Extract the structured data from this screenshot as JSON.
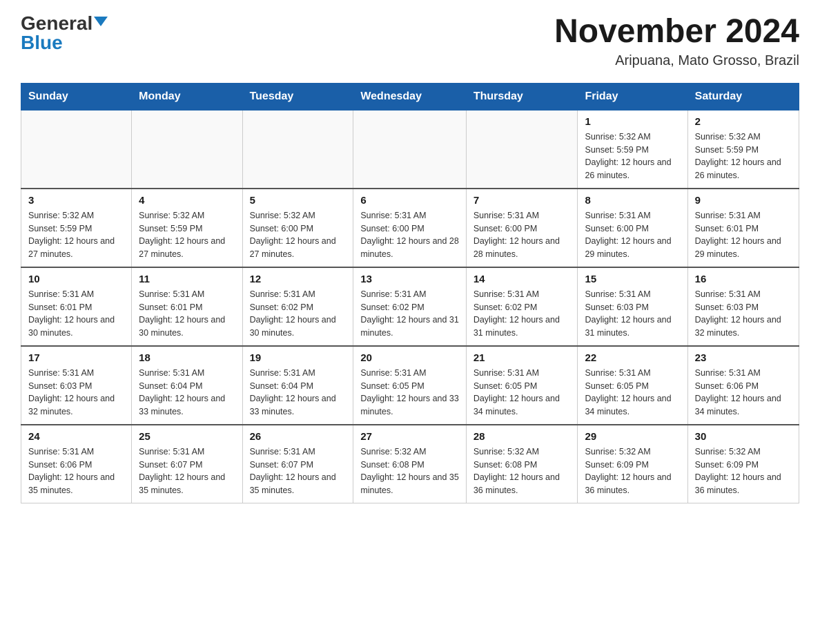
{
  "logo": {
    "general": "General",
    "blue": "Blue"
  },
  "title": "November 2024",
  "subtitle": "Aripuana, Mato Grosso, Brazil",
  "days_header": [
    "Sunday",
    "Monday",
    "Tuesday",
    "Wednesday",
    "Thursday",
    "Friday",
    "Saturday"
  ],
  "weeks": [
    [
      {
        "day": "",
        "info": ""
      },
      {
        "day": "",
        "info": ""
      },
      {
        "day": "",
        "info": ""
      },
      {
        "day": "",
        "info": ""
      },
      {
        "day": "",
        "info": ""
      },
      {
        "day": "1",
        "info": "Sunrise: 5:32 AM\nSunset: 5:59 PM\nDaylight: 12 hours and 26 minutes."
      },
      {
        "day": "2",
        "info": "Sunrise: 5:32 AM\nSunset: 5:59 PM\nDaylight: 12 hours and 26 minutes."
      }
    ],
    [
      {
        "day": "3",
        "info": "Sunrise: 5:32 AM\nSunset: 5:59 PM\nDaylight: 12 hours and 27 minutes."
      },
      {
        "day": "4",
        "info": "Sunrise: 5:32 AM\nSunset: 5:59 PM\nDaylight: 12 hours and 27 minutes."
      },
      {
        "day": "5",
        "info": "Sunrise: 5:32 AM\nSunset: 6:00 PM\nDaylight: 12 hours and 27 minutes."
      },
      {
        "day": "6",
        "info": "Sunrise: 5:31 AM\nSunset: 6:00 PM\nDaylight: 12 hours and 28 minutes."
      },
      {
        "day": "7",
        "info": "Sunrise: 5:31 AM\nSunset: 6:00 PM\nDaylight: 12 hours and 28 minutes."
      },
      {
        "day": "8",
        "info": "Sunrise: 5:31 AM\nSunset: 6:00 PM\nDaylight: 12 hours and 29 minutes."
      },
      {
        "day": "9",
        "info": "Sunrise: 5:31 AM\nSunset: 6:01 PM\nDaylight: 12 hours and 29 minutes."
      }
    ],
    [
      {
        "day": "10",
        "info": "Sunrise: 5:31 AM\nSunset: 6:01 PM\nDaylight: 12 hours and 30 minutes."
      },
      {
        "day": "11",
        "info": "Sunrise: 5:31 AM\nSunset: 6:01 PM\nDaylight: 12 hours and 30 minutes."
      },
      {
        "day": "12",
        "info": "Sunrise: 5:31 AM\nSunset: 6:02 PM\nDaylight: 12 hours and 30 minutes."
      },
      {
        "day": "13",
        "info": "Sunrise: 5:31 AM\nSunset: 6:02 PM\nDaylight: 12 hours and 31 minutes."
      },
      {
        "day": "14",
        "info": "Sunrise: 5:31 AM\nSunset: 6:02 PM\nDaylight: 12 hours and 31 minutes."
      },
      {
        "day": "15",
        "info": "Sunrise: 5:31 AM\nSunset: 6:03 PM\nDaylight: 12 hours and 31 minutes."
      },
      {
        "day": "16",
        "info": "Sunrise: 5:31 AM\nSunset: 6:03 PM\nDaylight: 12 hours and 32 minutes."
      }
    ],
    [
      {
        "day": "17",
        "info": "Sunrise: 5:31 AM\nSunset: 6:03 PM\nDaylight: 12 hours and 32 minutes."
      },
      {
        "day": "18",
        "info": "Sunrise: 5:31 AM\nSunset: 6:04 PM\nDaylight: 12 hours and 33 minutes."
      },
      {
        "day": "19",
        "info": "Sunrise: 5:31 AM\nSunset: 6:04 PM\nDaylight: 12 hours and 33 minutes."
      },
      {
        "day": "20",
        "info": "Sunrise: 5:31 AM\nSunset: 6:05 PM\nDaylight: 12 hours and 33 minutes."
      },
      {
        "day": "21",
        "info": "Sunrise: 5:31 AM\nSunset: 6:05 PM\nDaylight: 12 hours and 34 minutes."
      },
      {
        "day": "22",
        "info": "Sunrise: 5:31 AM\nSunset: 6:05 PM\nDaylight: 12 hours and 34 minutes."
      },
      {
        "day": "23",
        "info": "Sunrise: 5:31 AM\nSunset: 6:06 PM\nDaylight: 12 hours and 34 minutes."
      }
    ],
    [
      {
        "day": "24",
        "info": "Sunrise: 5:31 AM\nSunset: 6:06 PM\nDaylight: 12 hours and 35 minutes."
      },
      {
        "day": "25",
        "info": "Sunrise: 5:31 AM\nSunset: 6:07 PM\nDaylight: 12 hours and 35 minutes."
      },
      {
        "day": "26",
        "info": "Sunrise: 5:31 AM\nSunset: 6:07 PM\nDaylight: 12 hours and 35 minutes."
      },
      {
        "day": "27",
        "info": "Sunrise: 5:32 AM\nSunset: 6:08 PM\nDaylight: 12 hours and 35 minutes."
      },
      {
        "day": "28",
        "info": "Sunrise: 5:32 AM\nSunset: 6:08 PM\nDaylight: 12 hours and 36 minutes."
      },
      {
        "day": "29",
        "info": "Sunrise: 5:32 AM\nSunset: 6:09 PM\nDaylight: 12 hours and 36 minutes."
      },
      {
        "day": "30",
        "info": "Sunrise: 5:32 AM\nSunset: 6:09 PM\nDaylight: 12 hours and 36 minutes."
      }
    ]
  ]
}
